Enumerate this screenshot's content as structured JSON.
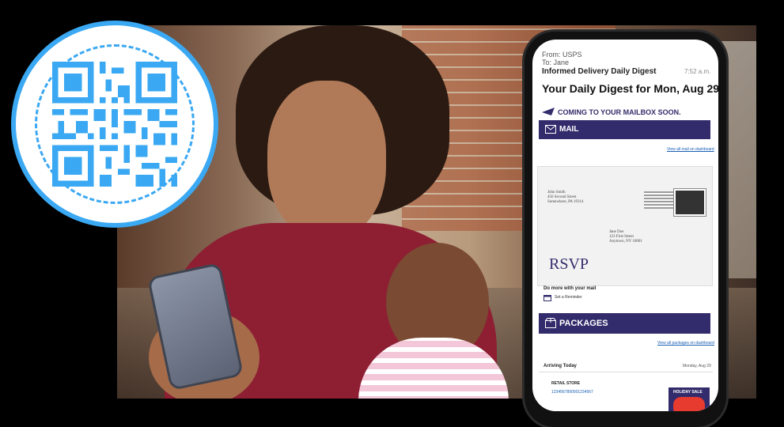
{
  "colors": {
    "qr_blue": "#3aa8f2",
    "usps_navy": "#332c6c",
    "link_blue": "#1a5fb4",
    "shirt_red": "#8e1f33"
  },
  "qr": {
    "icon": "qr-code-icon"
  },
  "phone": {
    "from": "From: USPS",
    "to": "To: Jane",
    "subject": "Informed Delivery Daily Digest",
    "time": "7:52 a.m.",
    "heading": "Your Daily Digest for Mon, Aug 29",
    "coming_soon": "COMING TO YOUR MAILBOX SOON.",
    "mail_label": "MAIL",
    "view_mail_link": "View all mail on dashboard",
    "envelope": {
      "sender_lines": [
        "John Smith",
        "456 Second Street",
        "Somewhere, PA 19314"
      ],
      "recipient_lines": [
        "Jane Doe",
        "123 First Street",
        "Anytown, NY 10001"
      ],
      "rsvp": "RSVP"
    },
    "do_more": "Do more with your mail",
    "reminder": "Set a Reminder",
    "packages_label": "PACKAGES",
    "view_packages_link": "View all packages on dashboard",
    "arriving": "Arriving Today",
    "arriving_date": "Monday, Aug 29",
    "retailer": "RETAIL STORE",
    "tracking": "1234567890001234567",
    "holiday": "HOLIDAY SALE"
  }
}
